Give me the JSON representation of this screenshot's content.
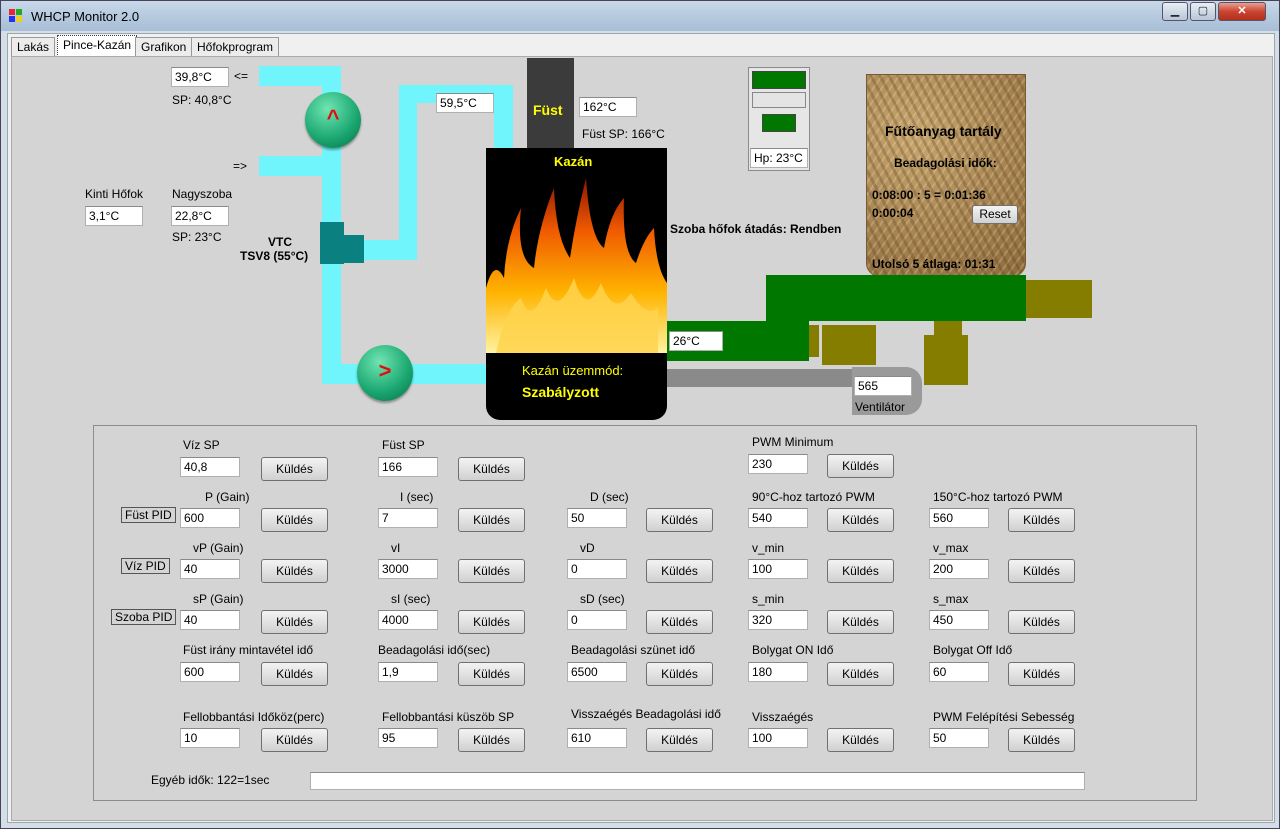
{
  "window": {
    "title": "WHCP Monitor 2.0",
    "min": "▁",
    "max": "▢",
    "close": "✕"
  },
  "tabs": [
    "Lakás",
    "Pince-Kazán",
    "Grafikon",
    "Hőfokprogram"
  ],
  "diagram": {
    "return_temp": "39,8°C",
    "return_arrow": "<=",
    "sp_return": "SP: 40,8°C",
    "flow_arrow": "=>",
    "pipe_temp": "59,5°C",
    "outdoor_label": "Kinti Hőfok",
    "outdoor_temp": "3,1°C",
    "room_label": "Nagyszoba",
    "room_temp": "22,8°C",
    "sp_room": "SP: 23°C",
    "valve_label_1": "VTC",
    "valve_label_2": "TSV8 (55°C)",
    "pump_up": "^",
    "pump_right": ">",
    "smoke_label": "Füst",
    "smoke_temp": "162°C",
    "smoke_sp": "Füst SP: 166°C",
    "boiler_label": "Kazán",
    "boiler_mode_label": "Kazán üzemmód:",
    "boiler_mode_value": "Szabályzott",
    "room_transfer": "Szoba hőfok átadás:  Rendben",
    "hp_temp": "Hp: 23°C",
    "auger_temp": "26°C",
    "fan_value": "565",
    "fan_label": "Ventilátor"
  },
  "fuel_tank": {
    "title": "Fűtőanyag tartály",
    "feed_times_label": "Beadagolási idők:",
    "line1": "0:08:00 : 5 = 0:01:36",
    "line2": "0:00:04",
    "reset": "Reset",
    "last5": "Utolsó 5 átlaga: 01:31"
  },
  "params": {
    "send": "Küldés",
    "viz_sp_label": "Víz SP",
    "viz_sp": "40,8",
    "fust_sp_label": "Füst SP",
    "fust_sp": "166",
    "pwm_min_label": "PWM Minimum",
    "pwm_min": "230",
    "fust_pid": "Füst PID",
    "viz_pid": "Víz  PID",
    "szoba_pid": "Szoba PID",
    "p_label": "P  (Gain)",
    "p": "600",
    "i_label": "I (sec)",
    "i": "7",
    "d_label": "D (sec)",
    "d": "50",
    "pwm90_label": "90°C-hoz tartozó PWM",
    "pwm90": "540",
    "pwm150_label": "150°C-hoz tartozó PWM",
    "pwm150": "560",
    "vp_label": "vP  (Gain)",
    "vp": "40",
    "vi_label": "vI",
    "vi": "3000",
    "vd_label": "vD",
    "vd": "0",
    "vmin_label": "v_min",
    "vmin": "100",
    "vmax_label": "v_max",
    "vmax": "200",
    "sp_label": "sP (Gain)",
    "sp": "40",
    "si_label": "sI (sec)",
    "si": "4000",
    "sd_label": "sD (sec)",
    "sd": "0",
    "smin_label": "s_min",
    "smin": "320",
    "smax_label": "s_max",
    "smax": "450",
    "fust_sample_label": "Füst irány mintavétel idő",
    "fust_sample": "600",
    "feed_time_label": "Beadagolási idő(sec)",
    "feed_time": "1,9",
    "feed_pause_label": "Beadagolási szünet idő",
    "feed_pause": "6500",
    "stir_on_label": "Bolygat ON Idő",
    "stir_on": "180",
    "stir_off_label": "Bolygat Off Idő",
    "stir_off": "60",
    "flare_interval_label": "Fellobbantási Időköz(perc)",
    "flare_interval": "10",
    "flare_threshold_label": "Fellobbantási küszöb SP",
    "flare_threshold": "95",
    "reburn_feed_label": "Visszaégés Beadagolási idő",
    "reburn_feed": "610",
    "reburn_label": "Visszaégés",
    "reburn": "100",
    "pwm_speed_label": "PWM Felépítési Sebesség",
    "pwm_speed": "50",
    "other_times": "Egyéb idők: 122=1sec",
    "other_input": ""
  },
  "colors": {
    "pipe": "#6ff5fb",
    "auger_green": "#007800",
    "motor_olive": "#857d00",
    "pump_green": "#19a56e"
  },
  "icons": {
    "pump": "pump-icon",
    "valve": "valve-icon",
    "flame": "flame-icon",
    "fan": "fan-icon"
  }
}
